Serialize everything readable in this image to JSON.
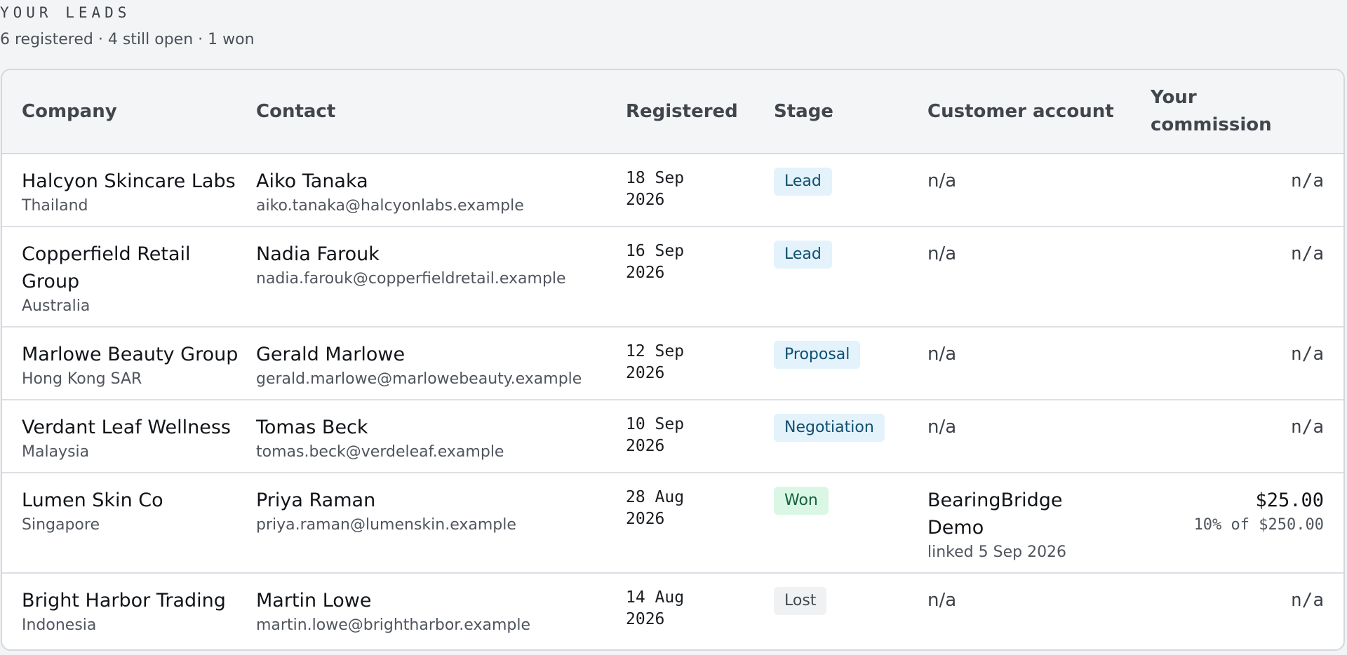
{
  "header": {
    "eyebrow": "YOUR LEADS",
    "summary": "6 registered · 4 still open · 1 won"
  },
  "table": {
    "columns": {
      "company": "Company",
      "contact": "Contact",
      "registered": "Registered",
      "stage": "Stage",
      "customer_account": "Customer account",
      "commission": "Your commission"
    },
    "rows": [
      {
        "company": "Halcyon Skincare Labs",
        "country": "Thailand",
        "contact_name": "Aiko Tanaka",
        "contact_email": "aiko.tanaka@halcyonlabs.example",
        "registered": "18 Sep 2026",
        "stage": "Lead",
        "account": "n/a",
        "commission": "n/a"
      },
      {
        "company": "Copperfield Retail Group",
        "country": "Australia",
        "contact_name": "Nadia Farouk",
        "contact_email": "nadia.farouk@copperfieldretail.example",
        "registered": "16 Sep 2026",
        "stage": "Lead",
        "account": "n/a",
        "commission": "n/a"
      },
      {
        "company": "Marlowe Beauty Group",
        "country": "Hong Kong SAR",
        "contact_name": "Gerald Marlowe",
        "contact_email": "gerald.marlowe@marlowebeauty.example",
        "registered": "12 Sep 2026",
        "stage": "Proposal",
        "account": "n/a",
        "commission": "n/a"
      },
      {
        "company": "Verdant Leaf Wellness",
        "country": "Malaysia",
        "contact_name": "Tomas Beck",
        "contact_email": "tomas.beck@verdeleaf.example",
        "registered": "10 Sep 2026",
        "stage": "Negotiation",
        "account": "n/a",
        "commission": "n/a"
      },
      {
        "company": "Lumen Skin Co",
        "country": "Singapore",
        "contact_name": "Priya Raman",
        "contact_email": "priya.raman@lumenskin.example",
        "registered": "28 Aug 2026",
        "stage": "Won",
        "account": "BearingBridge Demo",
        "account_linked": "linked 5 Sep 2026",
        "commission": "$25.00",
        "commission_detail": "10% of $250.00"
      },
      {
        "company": "Bright Harbor Trading",
        "country": "Indonesia",
        "contact_name": "Martin Lowe",
        "contact_email": "martin.lowe@brightharbor.example",
        "registered": "14 Aug 2026",
        "stage": "Lost",
        "account": "n/a",
        "commission": "n/a"
      }
    ]
  },
  "colors": {
    "page_bg": "#f3f4f6",
    "pill_open_bg": "#e3f2fb",
    "pill_open_text": "#0f4f6f",
    "pill_won_bg": "#daf7e5",
    "pill_won_text": "#15613b",
    "pill_lost_bg": "#f0f1f3",
    "pill_lost_text": "#444950"
  }
}
